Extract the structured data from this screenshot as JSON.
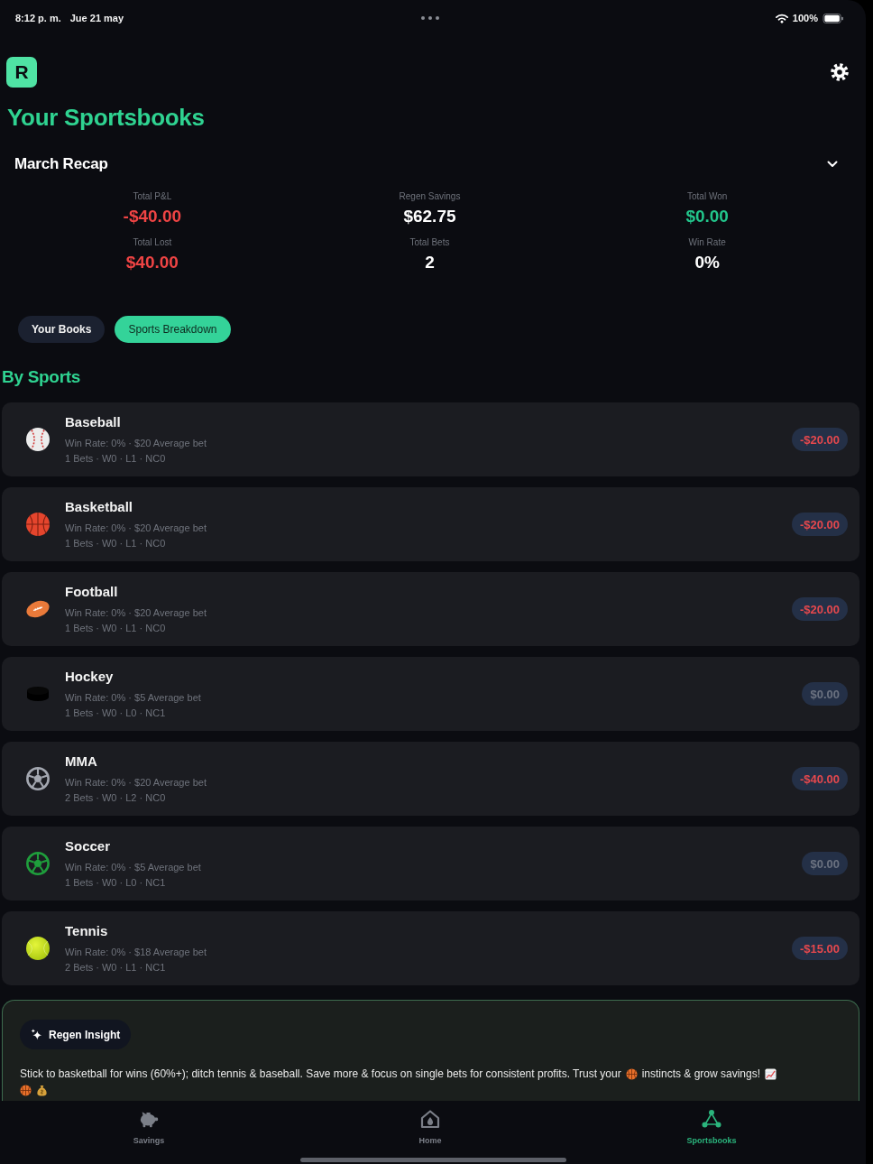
{
  "status_bar": {
    "time": "8:12 p. m.",
    "date": "Jue 21 may",
    "battery": "100%"
  },
  "logo": {
    "letter": "R"
  },
  "header": {
    "title": "Your Sportsbooks"
  },
  "recap": {
    "title": "March Recap",
    "stats": [
      {
        "label": "Total P&L",
        "value": "-$40.00",
        "color": "#ef4444"
      },
      {
        "label": "Regen Savings",
        "value": "$62.75",
        "color": "#ffffff"
      },
      {
        "label": "Total Won",
        "value": "$0.00",
        "color": "#22c58b"
      },
      {
        "label": "Total Lost",
        "value": "$40.00",
        "color": "#ef4444"
      },
      {
        "label": "Total Bets",
        "value": "2",
        "color": "#ffffff"
      },
      {
        "label": "Win Rate",
        "value": "0%",
        "color": "#ffffff"
      }
    ]
  },
  "tabs": [
    {
      "label": "Your Books",
      "selected": false
    },
    {
      "label": "Sports Breakdown",
      "selected": true
    }
  ],
  "section_title": "By Sports",
  "sports": [
    {
      "kind": "baseball",
      "name": "Baseball",
      "summary": "Win Rate: 0% · $20 Average bet",
      "record": "1 Bets · W0 · L1 · NC0",
      "amount": "-$20.00",
      "color": "#e5484d"
    },
    {
      "kind": "basketball",
      "name": "Basketball",
      "summary": "Win Rate: 0% · $20 Average bet",
      "record": "1 Bets · W0 · L1 · NC0",
      "amount": "-$20.00",
      "color": "#e5484d"
    },
    {
      "kind": "football",
      "name": "Football",
      "summary": "Win Rate: 0% · $20 Average bet",
      "record": "1 Bets · W0 · L1 · NC0",
      "amount": "-$20.00",
      "color": "#e5484d"
    },
    {
      "kind": "hockey",
      "name": "Hockey",
      "summary": "Win Rate: 0% · $5 Average bet",
      "record": "1 Bets · W0 · L0 · NC1",
      "amount": "$0.00",
      "color": "#6b7280"
    },
    {
      "kind": "mma",
      "name": "MMA",
      "summary": "Win Rate: 0% · $20 Average bet",
      "record": "2 Bets · W0 · L2 · NC0",
      "amount": "-$40.00",
      "color": "#e5484d"
    },
    {
      "kind": "soccer",
      "name": "Soccer",
      "summary": "Win Rate: 0% · $5 Average bet",
      "record": "1 Bets · W0 · L0 · NC1",
      "amount": "$0.00",
      "color": "#6b7280"
    },
    {
      "kind": "tennis",
      "name": "Tennis",
      "summary": "Win Rate: 0% · $18 Average bet",
      "record": "2 Bets · W0 · L1 · NC1",
      "amount": "-$15.00",
      "color": "#e5484d"
    }
  ],
  "insight": {
    "label": "Regen Insight",
    "text": [
      "Stick to basketball for wins (60%+); ditch tennis & baseball. Save more & focus on single bets for consistent profits. Trust your",
      "instincts & grow savings!"
    ]
  },
  "nav": [
    {
      "kind": "savings",
      "label": "Savings",
      "selected": false
    },
    {
      "kind": "home",
      "label": "Home",
      "selected": false
    },
    {
      "kind": "sportsbooks",
      "label": "Sportsbooks",
      "selected": true
    }
  ]
}
